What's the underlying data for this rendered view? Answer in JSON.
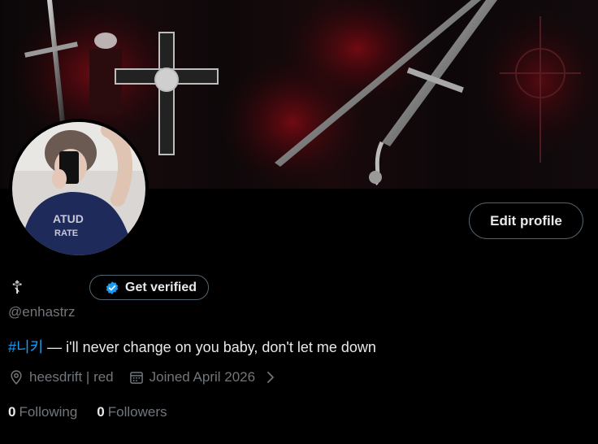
{
  "profile": {
    "name_glyph": "☦",
    "handle": "@enhastrz",
    "bio_hashtag": "#니키",
    "bio_text": " — i'll never change on you baby, don't let me down",
    "location": "heesdrift | red",
    "joined": "Joined April 2026"
  },
  "buttons": {
    "edit_profile": "Edit profile",
    "get_verified": "Get verified"
  },
  "stats": {
    "following_count": "0",
    "following_label": "Following",
    "followers_count": "0",
    "followers_label": "Followers"
  },
  "icons": {
    "verified": "verified-badge-icon",
    "location": "location-pin-icon",
    "calendar": "calendar-icon",
    "chevron": "chevron-right-icon"
  },
  "colors": {
    "background": "#000000",
    "text": "#e7e9ea",
    "muted": "#71767b",
    "accent": "#1d9bf0",
    "border": "#536471"
  }
}
